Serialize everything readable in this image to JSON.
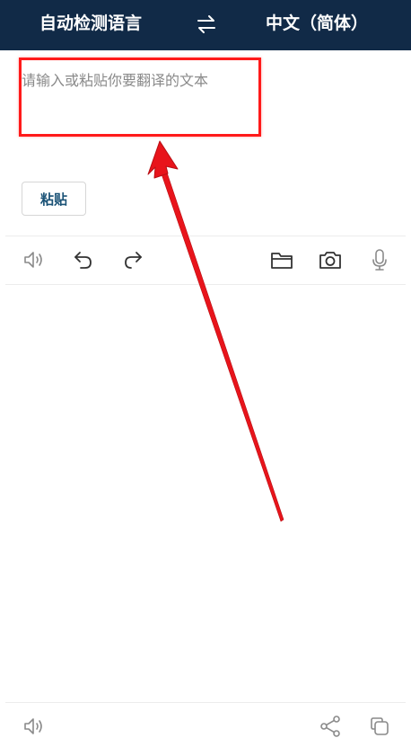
{
  "header": {
    "source_language": "自动检测语言",
    "target_language": "中文（简体）",
    "swap_icon": "swap-arrows-icon",
    "background_color": "#112a47"
  },
  "input": {
    "placeholder": "请输入或粘贴你要翻译的文本",
    "value": ""
  },
  "paste_button": {
    "label": "粘贴"
  },
  "input_toolbar": {
    "icons": [
      "speaker-icon",
      "undo-icon",
      "redo-icon",
      "folder-icon",
      "camera-icon",
      "microphone-icon"
    ]
  },
  "output_toolbar": {
    "icons": [
      "speaker-icon",
      "share-icon",
      "copy-icon"
    ]
  },
  "annotation": {
    "highlight_color": "#ff1a1a",
    "arrow_color": "#e8141b"
  }
}
